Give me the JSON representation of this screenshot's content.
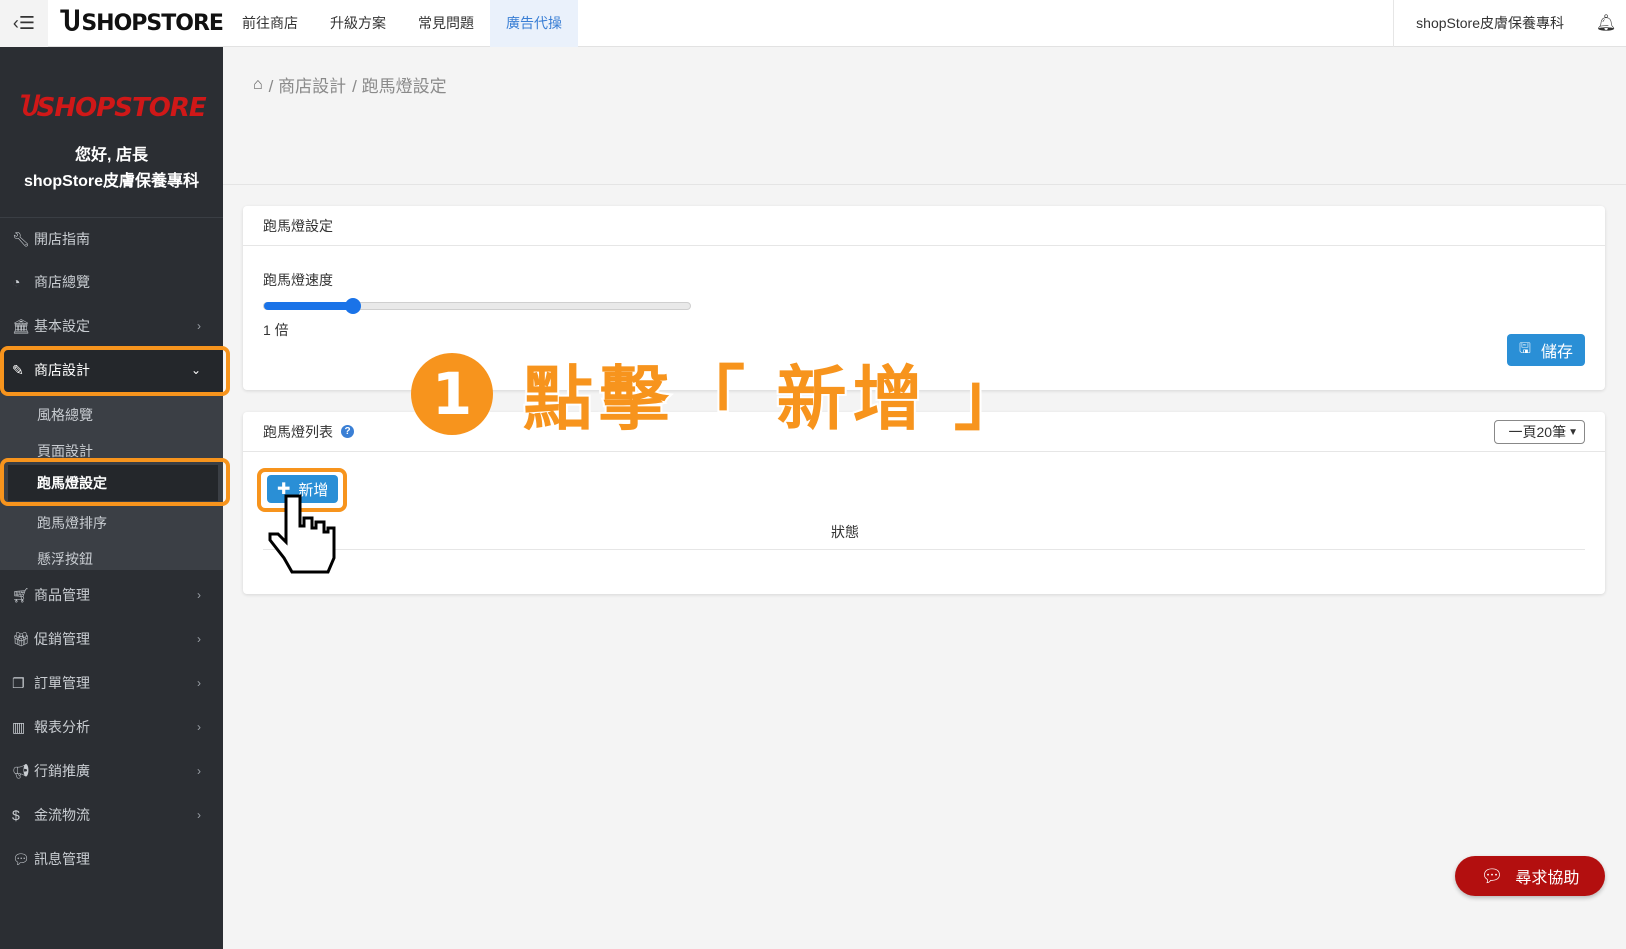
{
  "topbar": {
    "brand": "SHOPSTORE",
    "nav": [
      {
        "label": "前往商店"
      },
      {
        "label": "升級方案"
      },
      {
        "label": "常見問題"
      },
      {
        "label": "廣告代操"
      }
    ],
    "store_name": "shopStore皮膚保養專科"
  },
  "sidebar": {
    "logo": "SHOPSTORE",
    "greeting": "您好, 店長",
    "store_name": "shopStore皮膚保養專科",
    "items": [
      {
        "label": "開店指南",
        "icon": "wrench-icon"
      },
      {
        "label": "商店總覽",
        "icon": "dashboard-icon"
      },
      {
        "label": "基本設定",
        "icon": "bank-icon"
      },
      {
        "label": "商店設計",
        "icon": "magic-wand-icon"
      },
      {
        "label": "商品管理",
        "icon": "cart-icon"
      },
      {
        "label": "促銷管理",
        "icon": "gift-icon"
      },
      {
        "label": "訂單管理",
        "icon": "copy-icon"
      },
      {
        "label": "報表分析",
        "icon": "bar-chart-icon"
      },
      {
        "label": "行銷推廣",
        "icon": "bullhorn-icon"
      },
      {
        "label": "金流物流",
        "icon": "dollar-icon"
      },
      {
        "label": "訊息管理",
        "icon": "comments-icon"
      }
    ],
    "submenu": [
      {
        "label": "風格總覽"
      },
      {
        "label": "頁面設計"
      },
      {
        "label": "跑馬燈設定"
      },
      {
        "label": "跑馬燈排序"
      },
      {
        "label": "懸浮按鈕"
      }
    ]
  },
  "breadcrumb": {
    "part1": "/ 商店設計",
    "part2": "/ 跑馬燈設定"
  },
  "settings_card": {
    "title": "跑馬燈設定",
    "speed_label": "跑馬燈速度",
    "speed_value_text": "1 倍",
    "slider_fraction": 0.21,
    "save_label": "儲存"
  },
  "list_card": {
    "title": "跑馬燈列表",
    "per_page": "一頁20筆",
    "add_label": "新增",
    "status_header": "狀態"
  },
  "annotation": {
    "number": "1",
    "text": "點擊「 新增 」"
  },
  "help": {
    "label": "尋求協助"
  },
  "colors": {
    "accent_orange": "#f7941d",
    "primary_blue": "#2a8fd6",
    "help_red": "#b30f0f",
    "sidebar_bg": "#2b2e33"
  }
}
